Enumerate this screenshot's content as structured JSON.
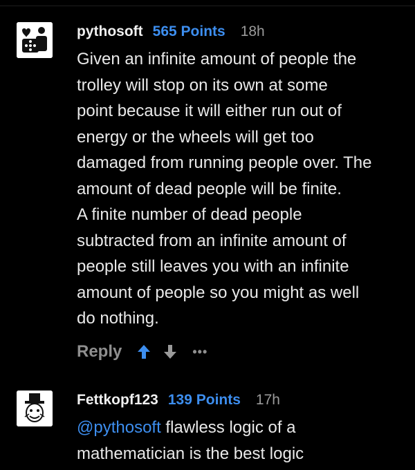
{
  "comments": [
    {
      "username": "pythosoft",
      "points": "565 Points",
      "time": "18h",
      "lines": [
        "Given an infinite amount of people the",
        "trolley will stop on its own at some",
        "point because it will either run out of",
        "energy or the wheels will get too",
        "damaged from running people over. The",
        "amount of dead people will be finite.",
        "A finite number of dead people",
        "subtracted from an infinite amount of",
        "people still leaves you with an infinite",
        "amount of people so you might as well",
        "do nothing."
      ],
      "reply_label": "Reply",
      "more_label": "•••"
    },
    {
      "username": "Fettkopf123",
      "points": "139 Points",
      "time": "17h",
      "mention": "@pythosoft",
      "line1_rest": " flawless logic of a",
      "line2": "mathematician is the best logic"
    }
  ],
  "colors": {
    "accent": "#3d8eef",
    "muted": "#8f8f8f",
    "background": "#000000"
  },
  "icons": [
    "avatar-pythosoft",
    "avatar-fettkopf",
    "upvote-arrow-icon",
    "downvote-arrow-icon",
    "more-options-icon"
  ]
}
